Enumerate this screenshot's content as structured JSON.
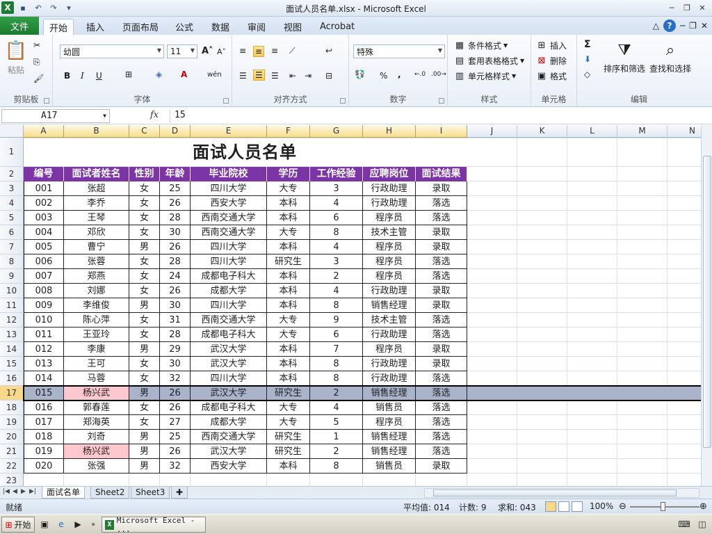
{
  "window": {
    "title": "面试人员名单.xlsx - Microsoft Excel"
  },
  "tabs": {
    "file": "文件",
    "items": [
      "开始",
      "插入",
      "页面布局",
      "公式",
      "数据",
      "审阅",
      "视图",
      "Acrobat"
    ],
    "active": "开始"
  },
  "ribbon": {
    "clipboard": {
      "label": "剪贴板",
      "paste": "粘贴"
    },
    "font": {
      "label": "字体",
      "name": "幼圆",
      "size": "11",
      "bold": "B",
      "italic": "I",
      "underline": "U",
      "wen": "wén"
    },
    "align": {
      "label": "对齐方式"
    },
    "number": {
      "label": "数字",
      "format": "特殊",
      "percent": "%",
      "comma": ","
    },
    "styles": {
      "label": "样式",
      "conditional": "条件格式",
      "table": "套用表格格式",
      "cell": "单元格样式"
    },
    "cells": {
      "label": "单元格",
      "insert": "插入",
      "delete": "删除",
      "format": "格式"
    },
    "editing": {
      "label": "编辑",
      "sigma": "Σ",
      "sort": "排序和筛选",
      "find": "查找和选择"
    }
  },
  "formula": {
    "namebox": "A17",
    "fx": "fx",
    "value": "15"
  },
  "columns": [
    "A",
    "B",
    "C",
    "D",
    "E",
    "F",
    "G",
    "H",
    "I",
    "J",
    "K",
    "L",
    "M",
    "N"
  ],
  "rows": [
    "1",
    "2",
    "3",
    "4",
    "5",
    "6",
    "7",
    "8",
    "9",
    "10",
    "11",
    "12",
    "13",
    "14",
    "15",
    "16",
    "17",
    "18",
    "19",
    "20",
    "21",
    "22",
    "23"
  ],
  "sheet_title": "面试人员名单",
  "table_headers": [
    "编号",
    "面试者姓名",
    "性别",
    "年龄",
    "毕业院校",
    "学历",
    "工作经验",
    "应聘岗位",
    "面试结果"
  ],
  "table_rows": [
    [
      "001",
      "张超",
      "女",
      "25",
      "四川大学",
      "大专",
      "3",
      "行政助理",
      "录取"
    ],
    [
      "002",
      "李乔",
      "女",
      "26",
      "西安大学",
      "本科",
      "4",
      "行政助理",
      "落选"
    ],
    [
      "003",
      "王琴",
      "女",
      "28",
      "西南交通大学",
      "本科",
      "6",
      "程序员",
      "落选"
    ],
    [
      "004",
      "邓欣",
      "女",
      "30",
      "西南交通大学",
      "大专",
      "8",
      "技术主管",
      "录取"
    ],
    [
      "005",
      "曹宁",
      "男",
      "26",
      "四川大学",
      "本科",
      "4",
      "程序员",
      "录取"
    ],
    [
      "006",
      "张蓉",
      "女",
      "28",
      "四川大学",
      "研究生",
      "3",
      "程序员",
      "落选"
    ],
    [
      "007",
      "郑燕",
      "女",
      "24",
      "成都电子科大",
      "本科",
      "2",
      "程序员",
      "落选"
    ],
    [
      "008",
      "刘娜",
      "女",
      "26",
      "成都大学",
      "本科",
      "4",
      "行政助理",
      "录取"
    ],
    [
      "009",
      "李维俊",
      "男",
      "30",
      "四川大学",
      "本科",
      "8",
      "销售经理",
      "录取"
    ],
    [
      "010",
      "陈心萍",
      "女",
      "31",
      "西南交通大学",
      "大专",
      "9",
      "技术主管",
      "落选"
    ],
    [
      "011",
      "王亚玲",
      "女",
      "28",
      "成都电子科大",
      "大专",
      "6",
      "行政助理",
      "落选"
    ],
    [
      "012",
      "李康",
      "男",
      "29",
      "武汉大学",
      "本科",
      "7",
      "程序员",
      "录取"
    ],
    [
      "013",
      "王可",
      "女",
      "30",
      "武汉大学",
      "本科",
      "8",
      "行政助理",
      "录取"
    ],
    [
      "014",
      "马蓉",
      "女",
      "32",
      "四川大学",
      "本科",
      "8",
      "行政助理",
      "落选"
    ],
    [
      "015",
      "杨兴武",
      "男",
      "26",
      "武汉大学",
      "研究生",
      "2",
      "销售经理",
      "落选"
    ],
    [
      "016",
      "郭春莲",
      "女",
      "26",
      "成都电子科大",
      "大专",
      "4",
      "销售员",
      "落选"
    ],
    [
      "017",
      "郑海英",
      "女",
      "27",
      "成都大学",
      "大专",
      "5",
      "程序员",
      "落选"
    ],
    [
      "018",
      "刘奇",
      "男",
      "25",
      "西南交通大学",
      "研究生",
      "1",
      "销售经理",
      "落选"
    ],
    [
      "019",
      "杨兴武",
      "男",
      "26",
      "武汉大学",
      "研究生",
      "2",
      "销售经理",
      "落选"
    ],
    [
      "020",
      "张强",
      "男",
      "32",
      "西安大学",
      "本科",
      "8",
      "销售员",
      "录取"
    ]
  ],
  "sheets": [
    "面试名单",
    "Sheet2",
    "Sheet3"
  ],
  "status": {
    "ready": "就绪",
    "avg": "平均值: 014",
    "count": "计数: 9",
    "sum": "求和: 043",
    "zoom": "100%"
  },
  "taskbar": {
    "start": "开始",
    "excel": "Microsoft Excel - ..."
  },
  "colors": {
    "header": "#7c35a4",
    "dup_highlight": "#ffc7ce",
    "selection": "#a9b4cb"
  }
}
